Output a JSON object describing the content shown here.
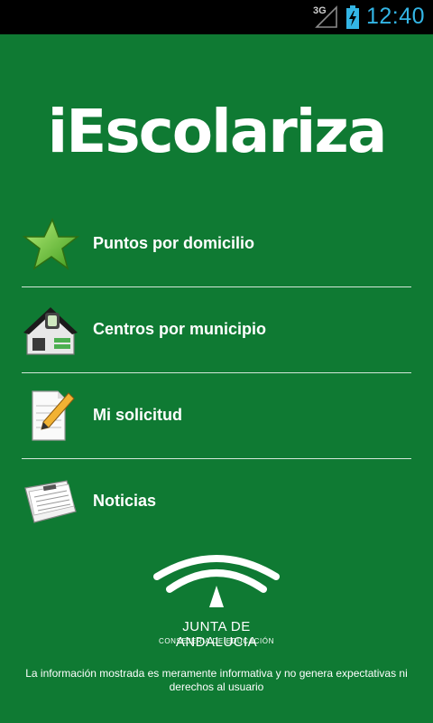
{
  "status_bar": {
    "network": "3G",
    "time": "12:40",
    "accent_color": "#33b5e5"
  },
  "app": {
    "title": "iEscolariza",
    "background_color": "#0f7a33"
  },
  "menu": {
    "items": [
      {
        "label": "Puntos por domicilio",
        "icon": "star-icon"
      },
      {
        "label": "Centros por municipio",
        "icon": "school-building-icon"
      },
      {
        "label": "Mi solicitud",
        "icon": "pencil-document-icon"
      },
      {
        "label": "Noticias",
        "icon": "newspaper-icon"
      }
    ]
  },
  "logo": {
    "name": "JUNTA DE ANDALUCIA",
    "subtitle": "CONSEJERIA DE EDUCACIÓN"
  },
  "disclaimer": "La información mostrada es meramente informativa y no genera expectativas ni derechos al usuario"
}
